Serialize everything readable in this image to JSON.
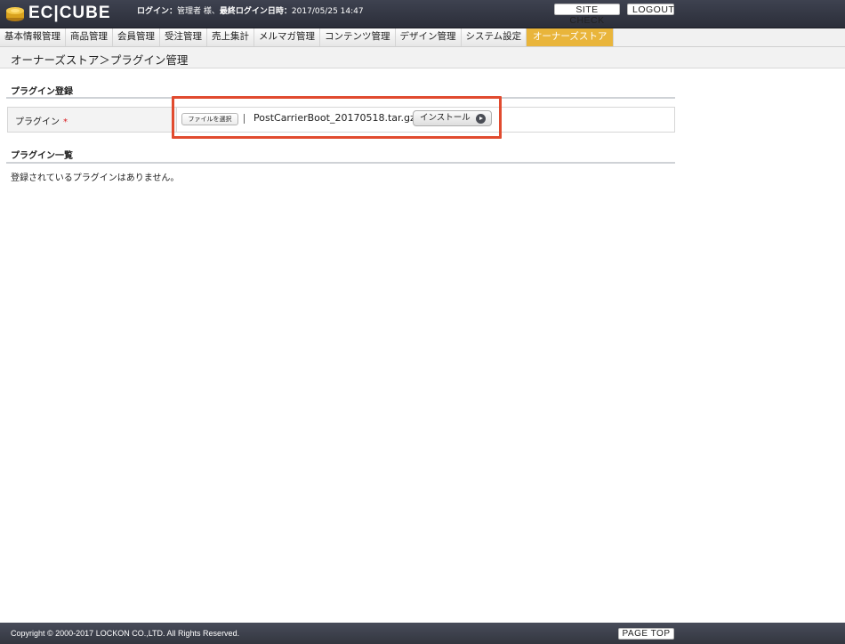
{
  "header": {
    "logo_text": "EC|CUBE",
    "login_prefix": "ログイン：",
    "user": "管理者",
    "user_suffix": " 様、",
    "last_login_label": "最終ログイン日時：",
    "last_login_value": "2017/05/25 14:47",
    "site_check": "SITE CHECK",
    "logout": "LOGOUT"
  },
  "nav": {
    "items": [
      {
        "label": "基本情報管理",
        "active": false
      },
      {
        "label": "商品管理",
        "active": false
      },
      {
        "label": "会員管理",
        "active": false
      },
      {
        "label": "受注管理",
        "active": false
      },
      {
        "label": "売上集計",
        "active": false
      },
      {
        "label": "メルマガ管理",
        "active": false
      },
      {
        "label": "コンテンツ管理",
        "active": false
      },
      {
        "label": "デザイン管理",
        "active": false
      },
      {
        "label": "システム設定",
        "active": false
      },
      {
        "label": "オーナーズストア",
        "active": true
      }
    ]
  },
  "page": {
    "title": "オーナーズストア＞プラグイン管理",
    "register_heading": "プラグイン登録",
    "plugin_label": "プラグイン",
    "required_mark": "*",
    "file_button": "ファイルを選択",
    "file_name": "PostCarrierBoot_20170518.tar.gz",
    "install_button": "インストール",
    "list_heading": "プラグイン一覧",
    "empty_message": "登録されているプラグインはありません。"
  },
  "colors": {
    "header_bg": "#2b2e39",
    "nav_active": "#e9b53b",
    "highlight": "#e14b2f",
    "required": "#d8171b"
  },
  "footer": {
    "copyright": "Copyright © 2000-2017 LOCKON CO.,LTD. All Rights Reserved.",
    "page_top": "PAGE TOP"
  }
}
